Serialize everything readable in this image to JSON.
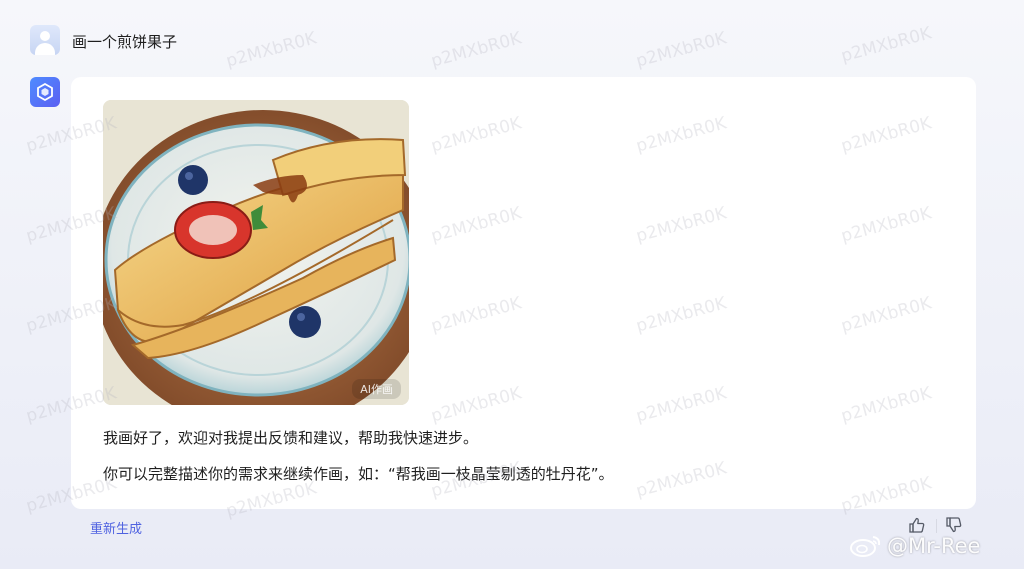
{
  "conversation": {
    "user_message": "画一个煎饼果子",
    "bot_reply": {
      "image_tag": "AI作画",
      "line1": "我画好了，欢迎对我提出反馈和建议，帮助我快速进步。",
      "line2": "你可以完整描述你的需求来继续作画，如：“帮我画一枝晶莹剔透的牡丹花”。"
    }
  },
  "actions": {
    "regenerate_label": "重新生成",
    "like_icon": "thumbs-up-icon",
    "dislike_icon": "thumbs-down-icon"
  },
  "watermark": {
    "text": "p2MXbR0K",
    "weibo_handle": "@Mr-Ree"
  },
  "colors": {
    "accent": "#4f62e0",
    "bot_avatar": "#5b6cf2",
    "card_bg": "#ffffff"
  }
}
